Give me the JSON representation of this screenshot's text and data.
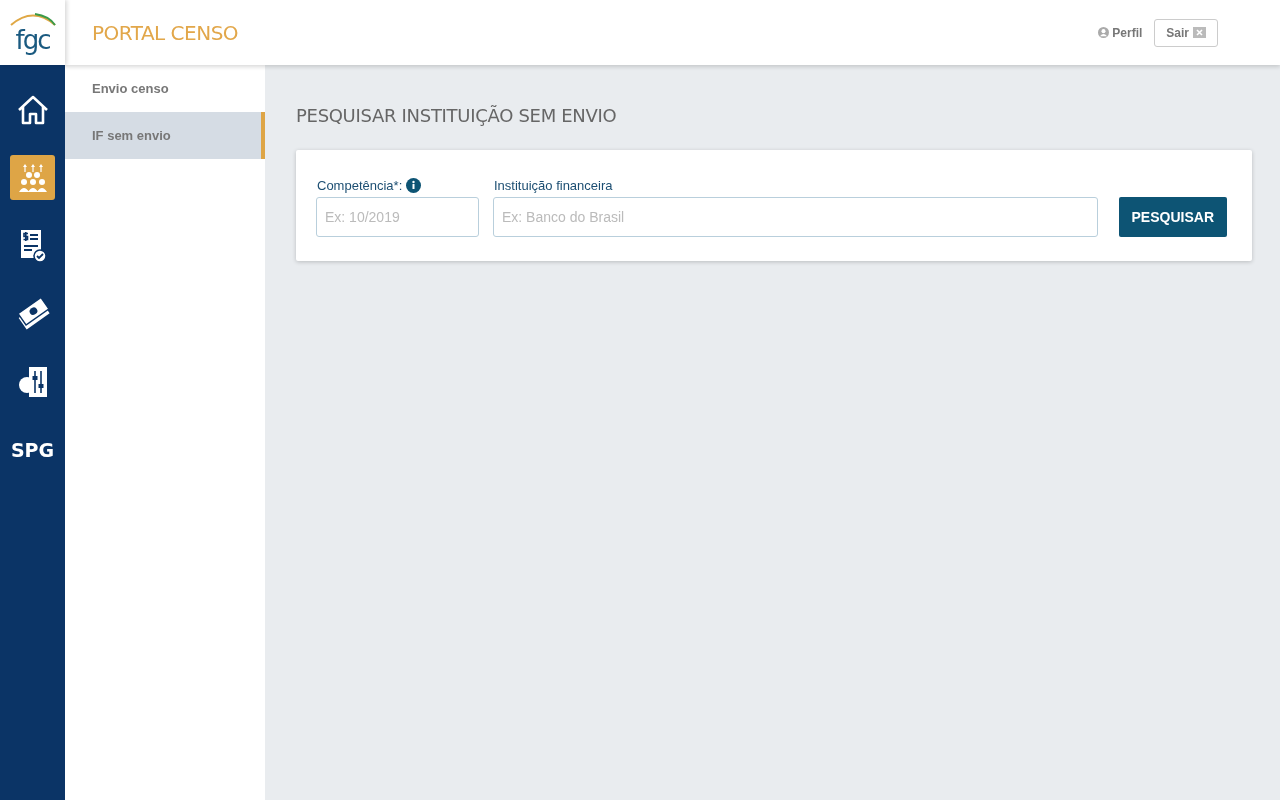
{
  "logo": {
    "text": "fgc"
  },
  "header": {
    "title": "PORTAL CENSO",
    "profile": "Perfil",
    "logout": "Sair"
  },
  "rail": [
    {
      "kind": "home",
      "selected": false
    },
    {
      "kind": "people",
      "selected": true
    },
    {
      "kind": "document",
      "selected": false
    },
    {
      "kind": "money",
      "selected": false
    },
    {
      "kind": "settings",
      "selected": false
    },
    {
      "kind": "text",
      "label": "SPG",
      "selected": false
    }
  ],
  "submenu": [
    {
      "label": "Envio censo",
      "selected": false
    },
    {
      "label": "IF sem envio",
      "selected": true
    }
  ],
  "page_title": "PESQUISAR INSTITUIÇÃO SEM ENVIO",
  "form": {
    "fields": [
      {
        "label": "Competência*:",
        "info": true,
        "placeholder": "Ex: 10/2019"
      },
      {
        "label": "Instituição financeira",
        "info": false,
        "placeholder": "Ex: Banco do Brasil"
      }
    ],
    "button": "PESQUISAR"
  }
}
